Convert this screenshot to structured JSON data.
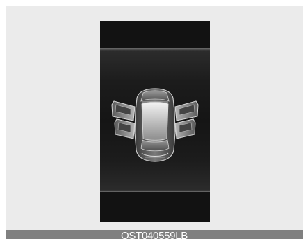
{
  "figure": {
    "caption": "OST040559LB",
    "background_color": "#ebebeb",
    "caption_bar_color": "#808080",
    "screen_color": "#111111"
  },
  "display": {
    "graphic": "vehicle-top-view-doors-open-icon",
    "open_doors": [
      "front-left",
      "front-right",
      "rear-left",
      "rear-right"
    ]
  }
}
